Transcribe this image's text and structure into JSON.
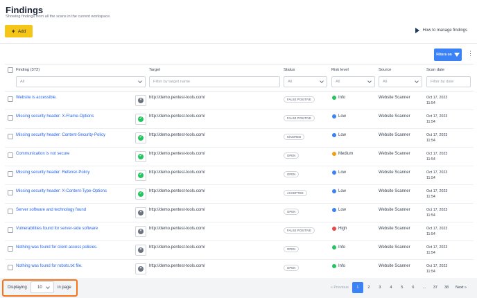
{
  "page": {
    "title": "Findings",
    "subtitle": "Showing findings from all the scans in the current workspace.",
    "add_label": "Add",
    "howto_label": "How to manage findings",
    "filters_label": "Filters on",
    "kebab": "⋮"
  },
  "table": {
    "columns": {
      "finding": "Finding (372)",
      "target": "Target",
      "status": "Status",
      "risk": "Risk level",
      "source": "Source",
      "date": "Scan date"
    },
    "filters": {
      "finding": "All",
      "target_placeholder": "Filter by target name",
      "status": "All",
      "risk": "All",
      "source": "All",
      "date_placeholder": "Filter by date"
    },
    "rows": [
      {
        "name": "Website is accessible.",
        "icon": "x",
        "target": "http://demo.pentest-tools.com/",
        "status": "FALSE POSITIVE",
        "risk": "Info",
        "risk_color": "#22c55e",
        "source": "Website Scanner",
        "date": "Oct 17, 2023",
        "time": "11:54"
      },
      {
        "name": "Missing security header: X-Frame-Options",
        "icon": "check",
        "target": "http://demo.pentest-tools.com/",
        "status": "FALSE POSITIVE",
        "risk": "Low",
        "risk_color": "#3b82f6",
        "source": "Website Scanner",
        "date": "Oct 17, 2023",
        "time": "11:54"
      },
      {
        "name": "Missing security header: Content-Security-Policy",
        "icon": "check",
        "target": "http://demo.pentest-tools.com/",
        "status": "IGNORED",
        "risk": "Low",
        "risk_color": "#3b82f6",
        "source": "Website Scanner",
        "date": "Oct 17, 2023",
        "time": "11:54"
      },
      {
        "name": "Communication is not secure",
        "icon": "check",
        "target": "http://demo.pentest-tools.com/",
        "status": "OPEN",
        "risk": "Medium",
        "risk_color": "#f59e0b",
        "source": "Website Scanner",
        "date": "Oct 17, 2023",
        "time": "11:54"
      },
      {
        "name": "Missing security header: Referrer-Policy",
        "icon": "check",
        "target": "http://demo.pentest-tools.com/",
        "status": "OPEN",
        "risk": "Low",
        "risk_color": "#3b82f6",
        "source": "Website Scanner",
        "date": "Oct 17, 2023",
        "time": "11:54"
      },
      {
        "name": "Missing security header: X-Content-Type-Options",
        "icon": "check",
        "target": "http://demo.pentest-tools.com/",
        "status": "ACCEPTED",
        "risk": "Low",
        "risk_color": "#3b82f6",
        "source": "Website Scanner",
        "date": "Oct 17, 2023",
        "time": "11:54"
      },
      {
        "name": "Server software and technology found",
        "icon": "x",
        "target": "http://demo.pentest-tools.com/",
        "status": "OPEN",
        "risk": "Low",
        "risk_color": "#3b82f6",
        "source": "Website Scanner",
        "date": "Oct 17, 2023",
        "time": "11:54"
      },
      {
        "name": "Vulnerabilities found for server-side software",
        "icon": "x",
        "target": "http://demo.pentest-tools.com/",
        "status": "FALSE POSITIVE",
        "risk": "High",
        "risk_color": "#ef4444",
        "source": "Website Scanner",
        "date": "Oct 17, 2023",
        "time": "11:54"
      },
      {
        "name": "Nothing was found for client access policies.",
        "icon": "x",
        "target": "http://demo.pentest-tools.com/",
        "status": "OPEN",
        "risk": "Info",
        "risk_color": "#22c55e",
        "source": "Website Scanner",
        "date": "Oct 17, 2023",
        "time": "11:54"
      },
      {
        "name": "Nothing was found for robots.txt file.",
        "icon": "x",
        "target": "http://demo.pentest-tools.com/",
        "status": "OPEN",
        "risk": "Info",
        "risk_color": "#22c55e",
        "source": "Website Scanner",
        "date": "Oct 17, 2023",
        "time": "11:54"
      }
    ]
  },
  "footer": {
    "displaying": "Displaying",
    "page_size": "10",
    "in_page": "in page",
    "pages": [
      "« Previous",
      "1",
      "2",
      "3",
      "4",
      "5",
      "6",
      "...",
      "37",
      "38",
      "Next »"
    ],
    "active_page": "1"
  },
  "colors": {
    "accent": "#3b82f6",
    "add_button": "#f5c518",
    "highlight_border": "#f97316"
  }
}
